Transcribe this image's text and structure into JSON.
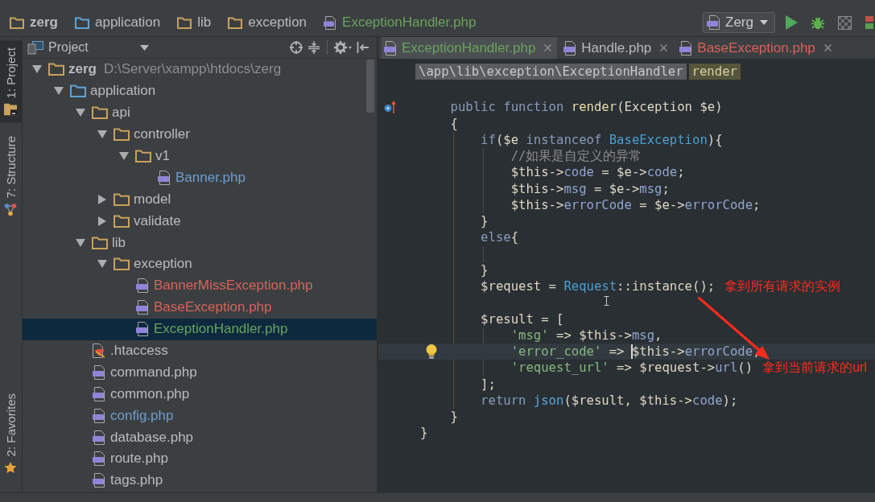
{
  "nav_bar": {
    "breadcrumbs": [
      {
        "label": "zerg",
        "kind": "project-folder",
        "color": "#bbbbbb"
      },
      {
        "label": "application",
        "kind": "source-folder",
        "color": "#bbbbbb"
      },
      {
        "label": "lib",
        "kind": "folder",
        "color": "#bbbbbb"
      },
      {
        "label": "exception",
        "kind": "folder",
        "color": "#bbbbbb"
      },
      {
        "label": "ExceptionHandler.php",
        "kind": "php-file",
        "color": "#6aa35e"
      }
    ],
    "run_config": {
      "label": "Zerg"
    }
  },
  "tool_windows": {
    "top": [
      {
        "label": "1: Project",
        "kind": "project",
        "selected": true
      },
      {
        "label": "7: Structure",
        "kind": "structure",
        "selected": false
      }
    ],
    "bottom": [
      {
        "label": "2: Favorites",
        "kind": "favorites",
        "selected": false
      }
    ]
  },
  "project_panel": {
    "title": "Project",
    "tree": [
      {
        "label": "zerg",
        "path": "D:\\Server\\xampp\\htdocs\\zerg",
        "kind": "project-folder",
        "expanded": true,
        "selected": false,
        "color": "#bbbbbb",
        "children": [
          {
            "label": "application",
            "kind": "source-folder",
            "expanded": true,
            "selected": false,
            "color": "#bbbbbb",
            "children": [
              {
                "label": "api",
                "kind": "folder",
                "expanded": true,
                "selected": false,
                "color": "#bbbbbb",
                "children": [
                  {
                    "label": "controller",
                    "kind": "folder",
                    "expanded": true,
                    "selected": false,
                    "color": "#bbbbbb",
                    "children": [
                      {
                        "label": "v1",
                        "kind": "folder",
                        "expanded": true,
                        "selected": false,
                        "color": "#bbbbbb",
                        "children": [
                          {
                            "label": "Banner.php",
                            "kind": "php-file",
                            "selected": false,
                            "color": "#6d9dce"
                          }
                        ]
                      }
                    ]
                  },
                  {
                    "label": "model",
                    "kind": "folder",
                    "expanded": false,
                    "selected": false,
                    "color": "#bbbbbb"
                  },
                  {
                    "label": "validate",
                    "kind": "folder",
                    "expanded": false,
                    "selected": false,
                    "color": "#bbbbbb"
                  }
                ]
              },
              {
                "label": "lib",
                "kind": "folder",
                "expanded": true,
                "selected": false,
                "color": "#bbbbbb",
                "children": [
                  {
                    "label": "exception",
                    "kind": "folder",
                    "expanded": true,
                    "selected": false,
                    "color": "#bbbbbb",
                    "children": [
                      {
                        "label": "BannerMissException.php",
                        "kind": "php-file",
                        "selected": false,
                        "color": "#d8625a"
                      },
                      {
                        "label": "BaseException.php",
                        "kind": "php-file",
                        "selected": false,
                        "color": "#d8625a"
                      },
                      {
                        "label": "ExceptionHandler.php",
                        "kind": "php-file",
                        "selected": true,
                        "color": "#6aa35e"
                      }
                    ]
                  }
                ]
              },
              {
                "label": ".htaccess",
                "kind": "config-file",
                "selected": false,
                "color": "#bbbbbb"
              },
              {
                "label": "command.php",
                "kind": "php-file",
                "selected": false,
                "color": "#bbbbbb"
              },
              {
                "label": "common.php",
                "kind": "php-file",
                "selected": false,
                "color": "#bbbbbb"
              },
              {
                "label": "config.php",
                "kind": "php-file",
                "selected": false,
                "color": "#6d9dce"
              },
              {
                "label": "database.php",
                "kind": "php-file",
                "selected": false,
                "color": "#bbbbbb"
              },
              {
                "label": "route.php",
                "kind": "php-file",
                "selected": false,
                "color": "#bbbbbb"
              },
              {
                "label": "tags.php",
                "kind": "php-file",
                "selected": false,
                "color": "#bbbbbb"
              }
            ]
          }
        ]
      }
    ]
  },
  "editor": {
    "tabs": [
      {
        "label": "ExceptionHandler.php",
        "selected": true,
        "color": "#6aa35e"
      },
      {
        "label": "Handle.php",
        "selected": false,
        "color": "#bbbbbb"
      },
      {
        "label": "BaseException.php",
        "selected": false,
        "color": "#d8625a"
      }
    ],
    "breadcrumb": [
      {
        "label": "\\app\\lib\\exception\\ExceptionHandler",
        "kind": "class"
      },
      {
        "label": "render",
        "kind": "method"
      }
    ],
    "lines": [
      {
        "overrides": true,
        "tokens": [
          {
            "text": "    public function ",
            "kind": "kw"
          },
          {
            "text": "render",
            "kind": "fn"
          },
          {
            "text": "(Exception $e)",
            "kind": "txt"
          }
        ]
      },
      {
        "tokens": [
          {
            "text": "    {",
            "kind": "txt"
          }
        ]
      },
      {
        "tokens": [
          {
            "text": "        if",
            "kind": "kw"
          },
          {
            "text": "($e ",
            "kind": "txt"
          },
          {
            "text": "instanceof ",
            "kind": "kw"
          },
          {
            "text": "BaseException",
            "kind": "cls"
          },
          {
            "text": "){",
            "kind": "txt"
          }
        ]
      },
      {
        "tokens": [
          {
            "text": "            //如果是自定义的异常",
            "kind": "cmt"
          }
        ]
      },
      {
        "tokens": [
          {
            "text": "            $this->",
            "kind": "txt"
          },
          {
            "text": "code",
            "kind": "fld"
          },
          {
            "text": " = $e->",
            "kind": "txt"
          },
          {
            "text": "code",
            "kind": "fld"
          },
          {
            "text": ";",
            "kind": "txt"
          }
        ]
      },
      {
        "tokens": [
          {
            "text": "            $this->",
            "kind": "txt"
          },
          {
            "text": "msg",
            "kind": "fld"
          },
          {
            "text": " = $e->",
            "kind": "txt"
          },
          {
            "text": "msg",
            "kind": "fld"
          },
          {
            "text": ";",
            "kind": "txt"
          }
        ]
      },
      {
        "tokens": [
          {
            "text": "            $this->",
            "kind": "txt"
          },
          {
            "text": "errorCode",
            "kind": "fld"
          },
          {
            "text": " = $e->",
            "kind": "txt"
          },
          {
            "text": "errorCode",
            "kind": "fld"
          },
          {
            "text": ";",
            "kind": "txt"
          }
        ]
      },
      {
        "tokens": [
          {
            "text": "        }",
            "kind": "txt"
          }
        ]
      },
      {
        "tokens": [
          {
            "text": "        else",
            "kind": "kw"
          },
          {
            "text": "{",
            "kind": "txt"
          }
        ]
      },
      {
        "blank_before": true,
        "tokens": [
          {
            "text": "        }",
            "kind": "txt"
          }
        ]
      },
      {
        "tokens": [
          {
            "text": "        $request = ",
            "kind": "txt"
          },
          {
            "text": "Request",
            "kind": "cls"
          },
          {
            "text": "::instance();",
            "kind": "txt"
          }
        ],
        "note": "拿到所有请求的实例"
      },
      {
        "blank_before": true,
        "tokens": [
          {
            "text": "        $result = [",
            "kind": "txt"
          }
        ]
      },
      {
        "tokens": [
          {
            "text": "            'msg'",
            "kind": "str"
          },
          {
            "text": " => $this->",
            "kind": "txt"
          },
          {
            "text": "msg",
            "kind": "fld"
          },
          {
            "text": ",",
            "kind": "txt"
          }
        ]
      },
      {
        "current": true,
        "intention": true,
        "tokens": [
          {
            "text": "            'error_code'",
            "kind": "str"
          },
          {
            "text": " => ",
            "kind": "txt"
          },
          {
            "text": "$this->",
            "kind": "txt",
            "caret": true
          },
          {
            "text": "errorCode",
            "kind": "fld"
          },
          {
            "text": ",",
            "kind": "txt"
          }
        ]
      },
      {
        "tokens": [
          {
            "text": "            'request_url'",
            "kind": "str"
          },
          {
            "text": " => $request->",
            "kind": "txt"
          },
          {
            "text": "url",
            "kind": "fld"
          },
          {
            "text": "()",
            "kind": "txt"
          }
        ],
        "note": "拿到当前请求的url"
      },
      {
        "tokens": [
          {
            "text": "        ];",
            "kind": "txt"
          }
        ]
      },
      {
        "tokens": [
          {
            "text": "        return ",
            "kind": "kw"
          },
          {
            "text": "json",
            "kind": "call"
          },
          {
            "text": "($result, $this->",
            "kind": "txt"
          },
          {
            "text": "code",
            "kind": "fld"
          },
          {
            "text": ");",
            "kind": "txt"
          }
        ]
      },
      {
        "tokens": [
          {
            "text": "    }",
            "kind": "txt"
          }
        ]
      },
      {
        "tokens": [
          {
            "text": "}",
            "kind": "txt"
          }
        ]
      }
    ]
  }
}
